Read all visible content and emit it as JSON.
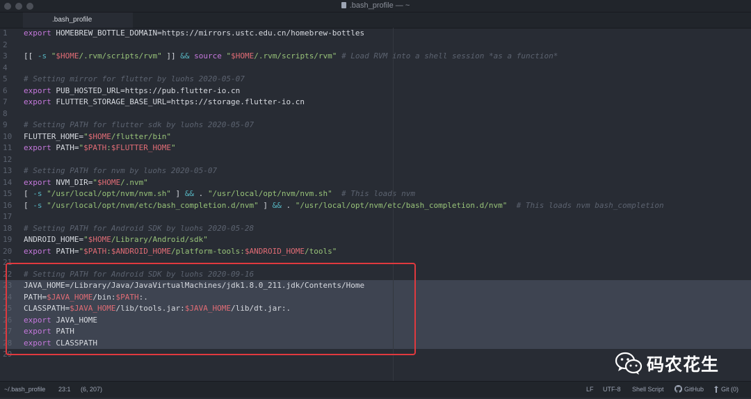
{
  "window": {
    "title": ".bash_profile — ~"
  },
  "tabs": [
    {
      "label": ".bash_profile",
      "active": true
    }
  ],
  "editor": {
    "language": "Shell Script",
    "lines": [
      {
        "n": "1",
        "tokens": [
          [
            "kw",
            "export"
          ],
          [
            "plain",
            " HOMEBREW_BOTTLE_DOMAIN=https://mirrors.ustc.edu.cn/homebrew-bottles"
          ]
        ]
      },
      {
        "n": "2",
        "tokens": []
      },
      {
        "n": "3",
        "tokens": [
          [
            "plain",
            "[[ "
          ],
          [
            "op",
            "-s"
          ],
          [
            "plain",
            " "
          ],
          [
            "str",
            "\""
          ],
          [
            "var",
            "$HOME"
          ],
          [
            "str",
            "/.rvm/scripts/rvm\""
          ],
          [
            "plain",
            " ]] "
          ],
          [
            "op",
            "&&"
          ],
          [
            "plain",
            " "
          ],
          [
            "kw",
            "source"
          ],
          [
            "plain",
            " "
          ],
          [
            "str",
            "\""
          ],
          [
            "var",
            "$HOME"
          ],
          [
            "str",
            "/.rvm/scripts/rvm\""
          ],
          [
            "plain",
            " "
          ],
          [
            "cmt",
            "# Load RVM into a shell session *as a function*"
          ]
        ]
      },
      {
        "n": "4",
        "tokens": []
      },
      {
        "n": "5",
        "tokens": [
          [
            "cmt",
            "# Setting mirror for flutter by luohs 2020-05-07"
          ]
        ]
      },
      {
        "n": "6",
        "tokens": [
          [
            "kw",
            "export"
          ],
          [
            "plain",
            " PUB_HOSTED_URL=https://pub.flutter-io.cn"
          ]
        ]
      },
      {
        "n": "7",
        "tokens": [
          [
            "kw",
            "export"
          ],
          [
            "plain",
            " FLUTTER_STORAGE_BASE_URL=https://storage.flutter-io.cn"
          ]
        ]
      },
      {
        "n": "8",
        "tokens": []
      },
      {
        "n": "9",
        "tokens": [
          [
            "cmt",
            "# Setting PATH for flutter sdk by luohs 2020-05-07"
          ]
        ]
      },
      {
        "n": "10",
        "tokens": [
          [
            "plain",
            "FLUTTER_HOME="
          ],
          [
            "str",
            "\""
          ],
          [
            "var",
            "$HOME"
          ],
          [
            "str",
            "/flutter/bin\""
          ]
        ]
      },
      {
        "n": "11",
        "tokens": [
          [
            "kw",
            "export"
          ],
          [
            "plain",
            " PATH="
          ],
          [
            "str",
            "\""
          ],
          [
            "var",
            "$PATH"
          ],
          [
            "str",
            ":"
          ],
          [
            "var",
            "$FLUTTER_HOME"
          ],
          [
            "str",
            "\""
          ]
        ]
      },
      {
        "n": "12",
        "tokens": []
      },
      {
        "n": "13",
        "tokens": [
          [
            "cmt",
            "# Setting PATH for nvm by luohs 2020-05-07"
          ]
        ]
      },
      {
        "n": "14",
        "tokens": [
          [
            "kw",
            "export"
          ],
          [
            "plain",
            " NVM_DIR="
          ],
          [
            "str",
            "\""
          ],
          [
            "var",
            "$HOME"
          ],
          [
            "str",
            "/.nvm\""
          ]
        ]
      },
      {
        "n": "15",
        "tokens": [
          [
            "plain",
            "[ "
          ],
          [
            "op",
            "-s"
          ],
          [
            "plain",
            " "
          ],
          [
            "str",
            "\"/usr/local/opt/nvm/nvm.sh\""
          ],
          [
            "plain",
            " ] "
          ],
          [
            "op",
            "&&"
          ],
          [
            "plain",
            " . "
          ],
          [
            "str",
            "\"/usr/local/opt/nvm/nvm.sh\""
          ],
          [
            "plain",
            "  "
          ],
          [
            "cmt",
            "# This loads nvm"
          ]
        ]
      },
      {
        "n": "16",
        "tokens": [
          [
            "plain",
            "[ "
          ],
          [
            "op",
            "-s"
          ],
          [
            "plain",
            " "
          ],
          [
            "str",
            "\"/usr/local/opt/nvm/etc/bash_completion.d/nvm\""
          ],
          [
            "plain",
            " ] "
          ],
          [
            "op",
            "&&"
          ],
          [
            "plain",
            " . "
          ],
          [
            "str",
            "\"/usr/local/opt/nvm/etc/bash_completion.d/nvm\""
          ],
          [
            "plain",
            "  "
          ],
          [
            "cmt",
            "# This loads nvm bash_completion"
          ]
        ]
      },
      {
        "n": "17",
        "tokens": []
      },
      {
        "n": "18",
        "tokens": [
          [
            "cmt",
            "# Setting PATH for Android SDK by luohs 2020-05-28"
          ]
        ]
      },
      {
        "n": "19",
        "tokens": [
          [
            "plain",
            "ANDROID_HOME="
          ],
          [
            "str",
            "\""
          ],
          [
            "var",
            "$HOME"
          ],
          [
            "str",
            "/Library/Android/sdk\""
          ]
        ]
      },
      {
        "n": "20",
        "tokens": [
          [
            "kw",
            "export"
          ],
          [
            "plain",
            " PATH="
          ],
          [
            "str",
            "\""
          ],
          [
            "var",
            "$PATH"
          ],
          [
            "str",
            ":"
          ],
          [
            "var",
            "$ANDROID_HOME"
          ],
          [
            "str",
            "/platform-tools:"
          ],
          [
            "var",
            "$ANDROID_HOME"
          ],
          [
            "str",
            "/tools\""
          ]
        ]
      },
      {
        "n": "21",
        "tokens": []
      },
      {
        "n": "22",
        "tokens": [
          [
            "cmt",
            "# Setting PATH for Android SDK by luohs 2020-09-16"
          ]
        ]
      },
      {
        "n": "23",
        "sel": true,
        "tokens": [
          [
            "plain",
            "JAVA_HOME=/Library/Java/JavaVirtualMachines/jdk1.8.0_211.jdk/Contents/Home"
          ]
        ]
      },
      {
        "n": "24",
        "sel": true,
        "tokens": [
          [
            "plain",
            "PATH="
          ],
          [
            "var",
            "$JAVA_HOME"
          ],
          [
            "plain",
            "/bin:"
          ],
          [
            "var",
            "$PATH"
          ],
          [
            "plain",
            ":."
          ]
        ]
      },
      {
        "n": "25",
        "sel": true,
        "tokens": [
          [
            "plain",
            "CLASSPATH="
          ],
          [
            "var",
            "$JAVA_HOME"
          ],
          [
            "plain",
            "/lib/tools.jar:"
          ],
          [
            "var",
            "$JAVA_HOME"
          ],
          [
            "plain",
            "/lib/dt.jar:."
          ]
        ]
      },
      {
        "n": "26",
        "sel": true,
        "tokens": [
          [
            "kw",
            "export"
          ],
          [
            "plain",
            " JAVA_HOME"
          ]
        ]
      },
      {
        "n": "27",
        "sel": true,
        "tokens": [
          [
            "kw",
            "export"
          ],
          [
            "plain",
            " PATH"
          ]
        ]
      },
      {
        "n": "28",
        "sel": true,
        "tokens": [
          [
            "kw",
            "export"
          ],
          [
            "plain",
            " CLASSPATH"
          ]
        ]
      },
      {
        "n": "29",
        "tokens": []
      }
    ]
  },
  "watermark": {
    "text": "码农花生",
    "icon": "wechat-icon"
  },
  "statusbar": {
    "file_path": "~/.bash_profile",
    "cursor": "23:1",
    "selection": "(6, 207)",
    "line_ending": "LF",
    "encoding": "UTF-8",
    "grammar": "Shell Script",
    "github": "GitHub",
    "git": "Git (0)"
  },
  "colors": {
    "background": "#282c34",
    "keyword": "#c678dd",
    "string": "#98c379",
    "variable": "#e06c75",
    "comment": "#5c6370",
    "highlight_box": "#e0393e"
  }
}
